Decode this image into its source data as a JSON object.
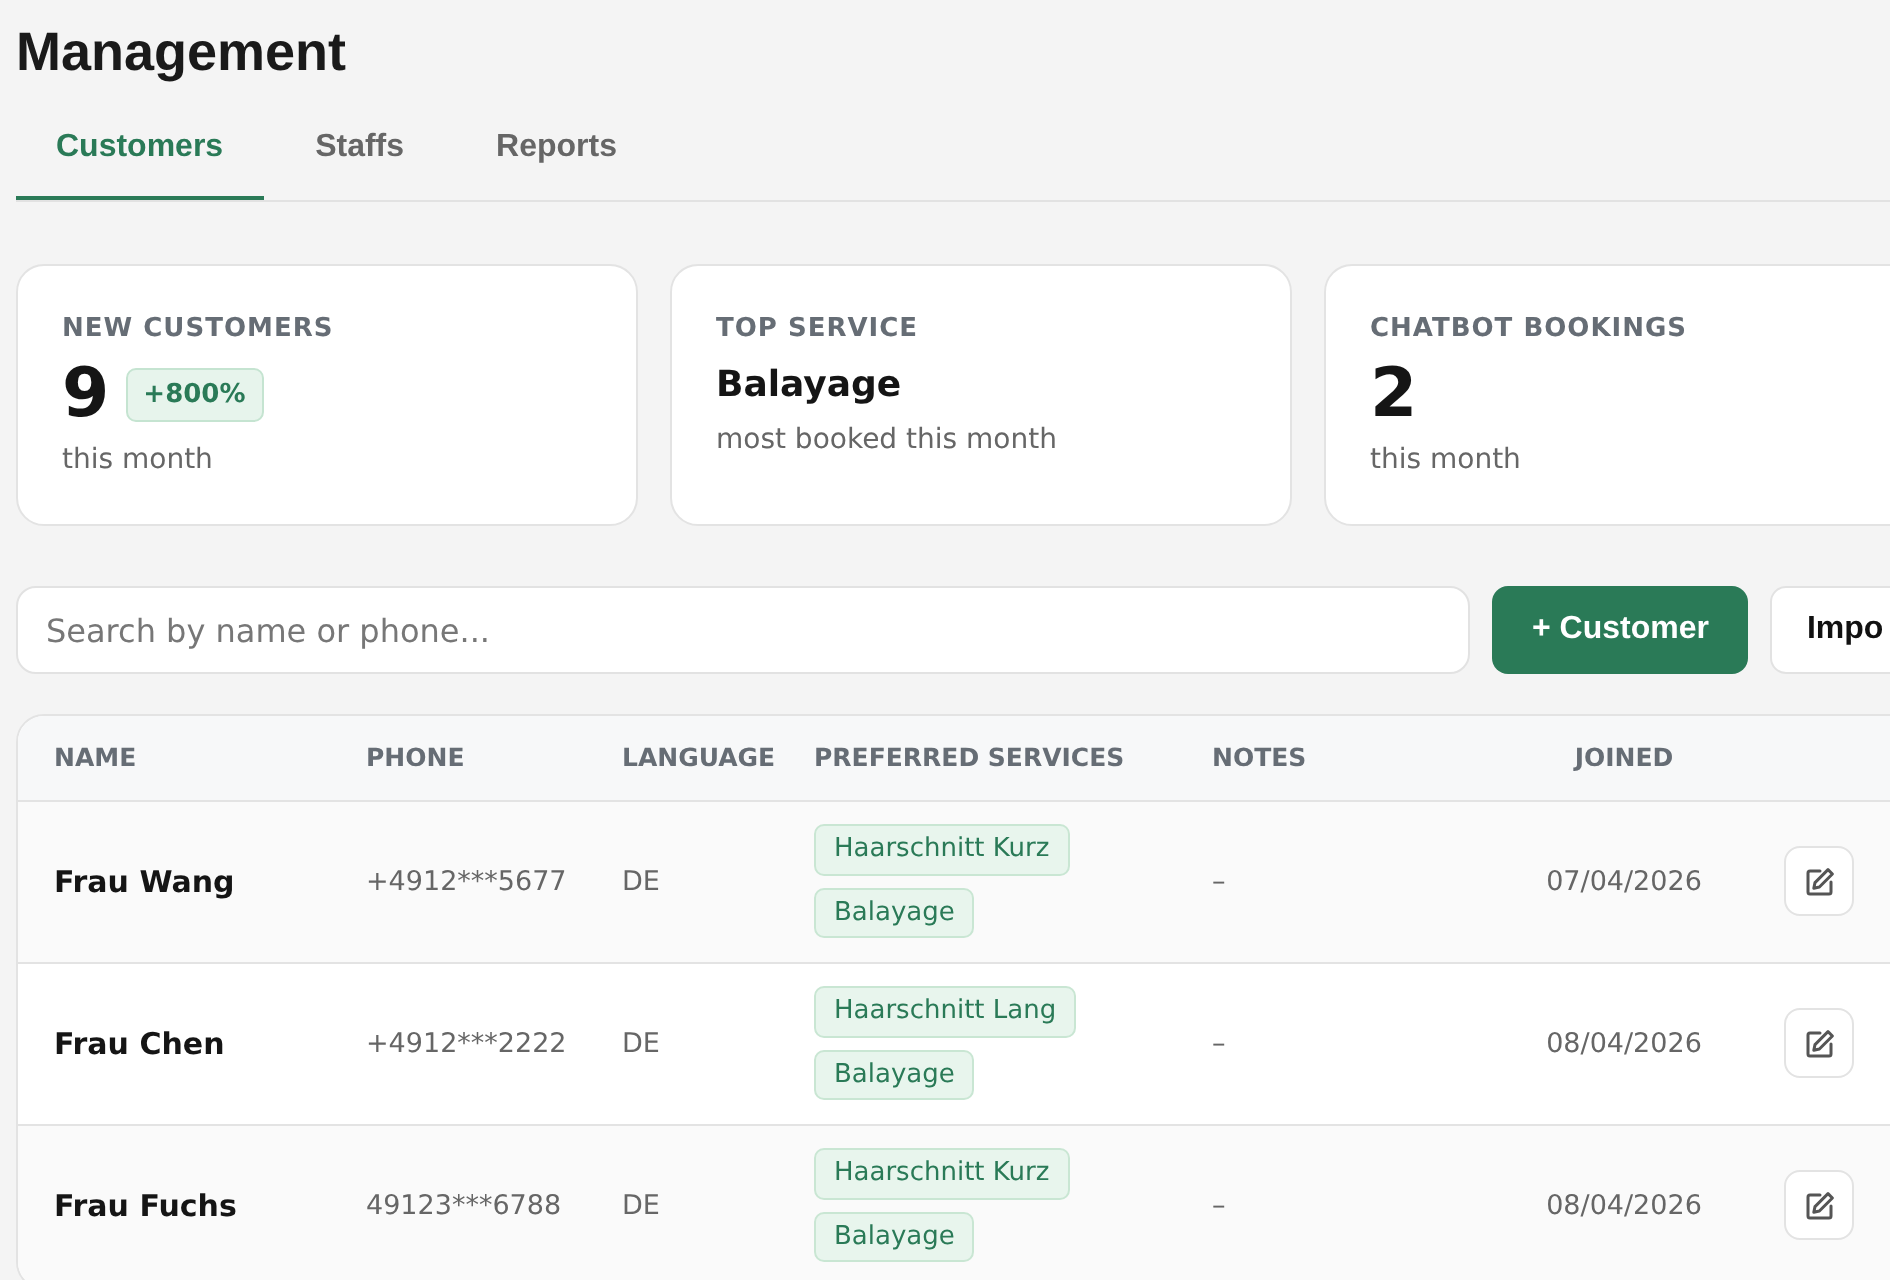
{
  "page_title": "Management",
  "tabs": [
    {
      "label": "Customers",
      "selected": true
    },
    {
      "label": "Staffs",
      "selected": false
    },
    {
      "label": "Reports",
      "selected": false
    }
  ],
  "stats": [
    {
      "kind": "number",
      "label": "NEW CUSTOMERS",
      "value": "9",
      "badge": "+800%",
      "caption": "this month"
    },
    {
      "kind": "text",
      "label": "TOP SERVICE",
      "value": "Balayage",
      "caption": "most booked this month"
    },
    {
      "kind": "number",
      "label": "CHATBOT BOOKINGS",
      "value": "2",
      "caption": "this month"
    }
  ],
  "search": {
    "placeholder": "Search by name or phone..."
  },
  "buttons": [
    {
      "kind": "primary",
      "label": "+ Customer"
    },
    {
      "kind": "secondary",
      "label": "Impo"
    }
  ],
  "table": {
    "columns": [
      "NAME",
      "PHONE",
      "LANGUAGE",
      "PREFERRED SERVICES",
      "NOTES",
      "JOINED"
    ],
    "rows": [
      {
        "name": "Frau Wang",
        "phone": "+4912***5677",
        "language": "DE",
        "services": [
          "Haarschnitt Kurz",
          "Balayage"
        ],
        "notes": "–",
        "joined": "07/04/2026"
      },
      {
        "name": "Frau Chen",
        "phone": "+4912***2222",
        "language": "DE",
        "services": [
          "Haarschnitt Lang",
          "Balayage"
        ],
        "notes": "–",
        "joined": "08/04/2026"
      },
      {
        "name": "Frau Fuchs",
        "phone": "49123***6788",
        "language": "DE",
        "services": [
          "Haarschnitt Kurz",
          "Balayage"
        ],
        "notes": "–",
        "joined": "08/04/2026"
      }
    ]
  }
}
